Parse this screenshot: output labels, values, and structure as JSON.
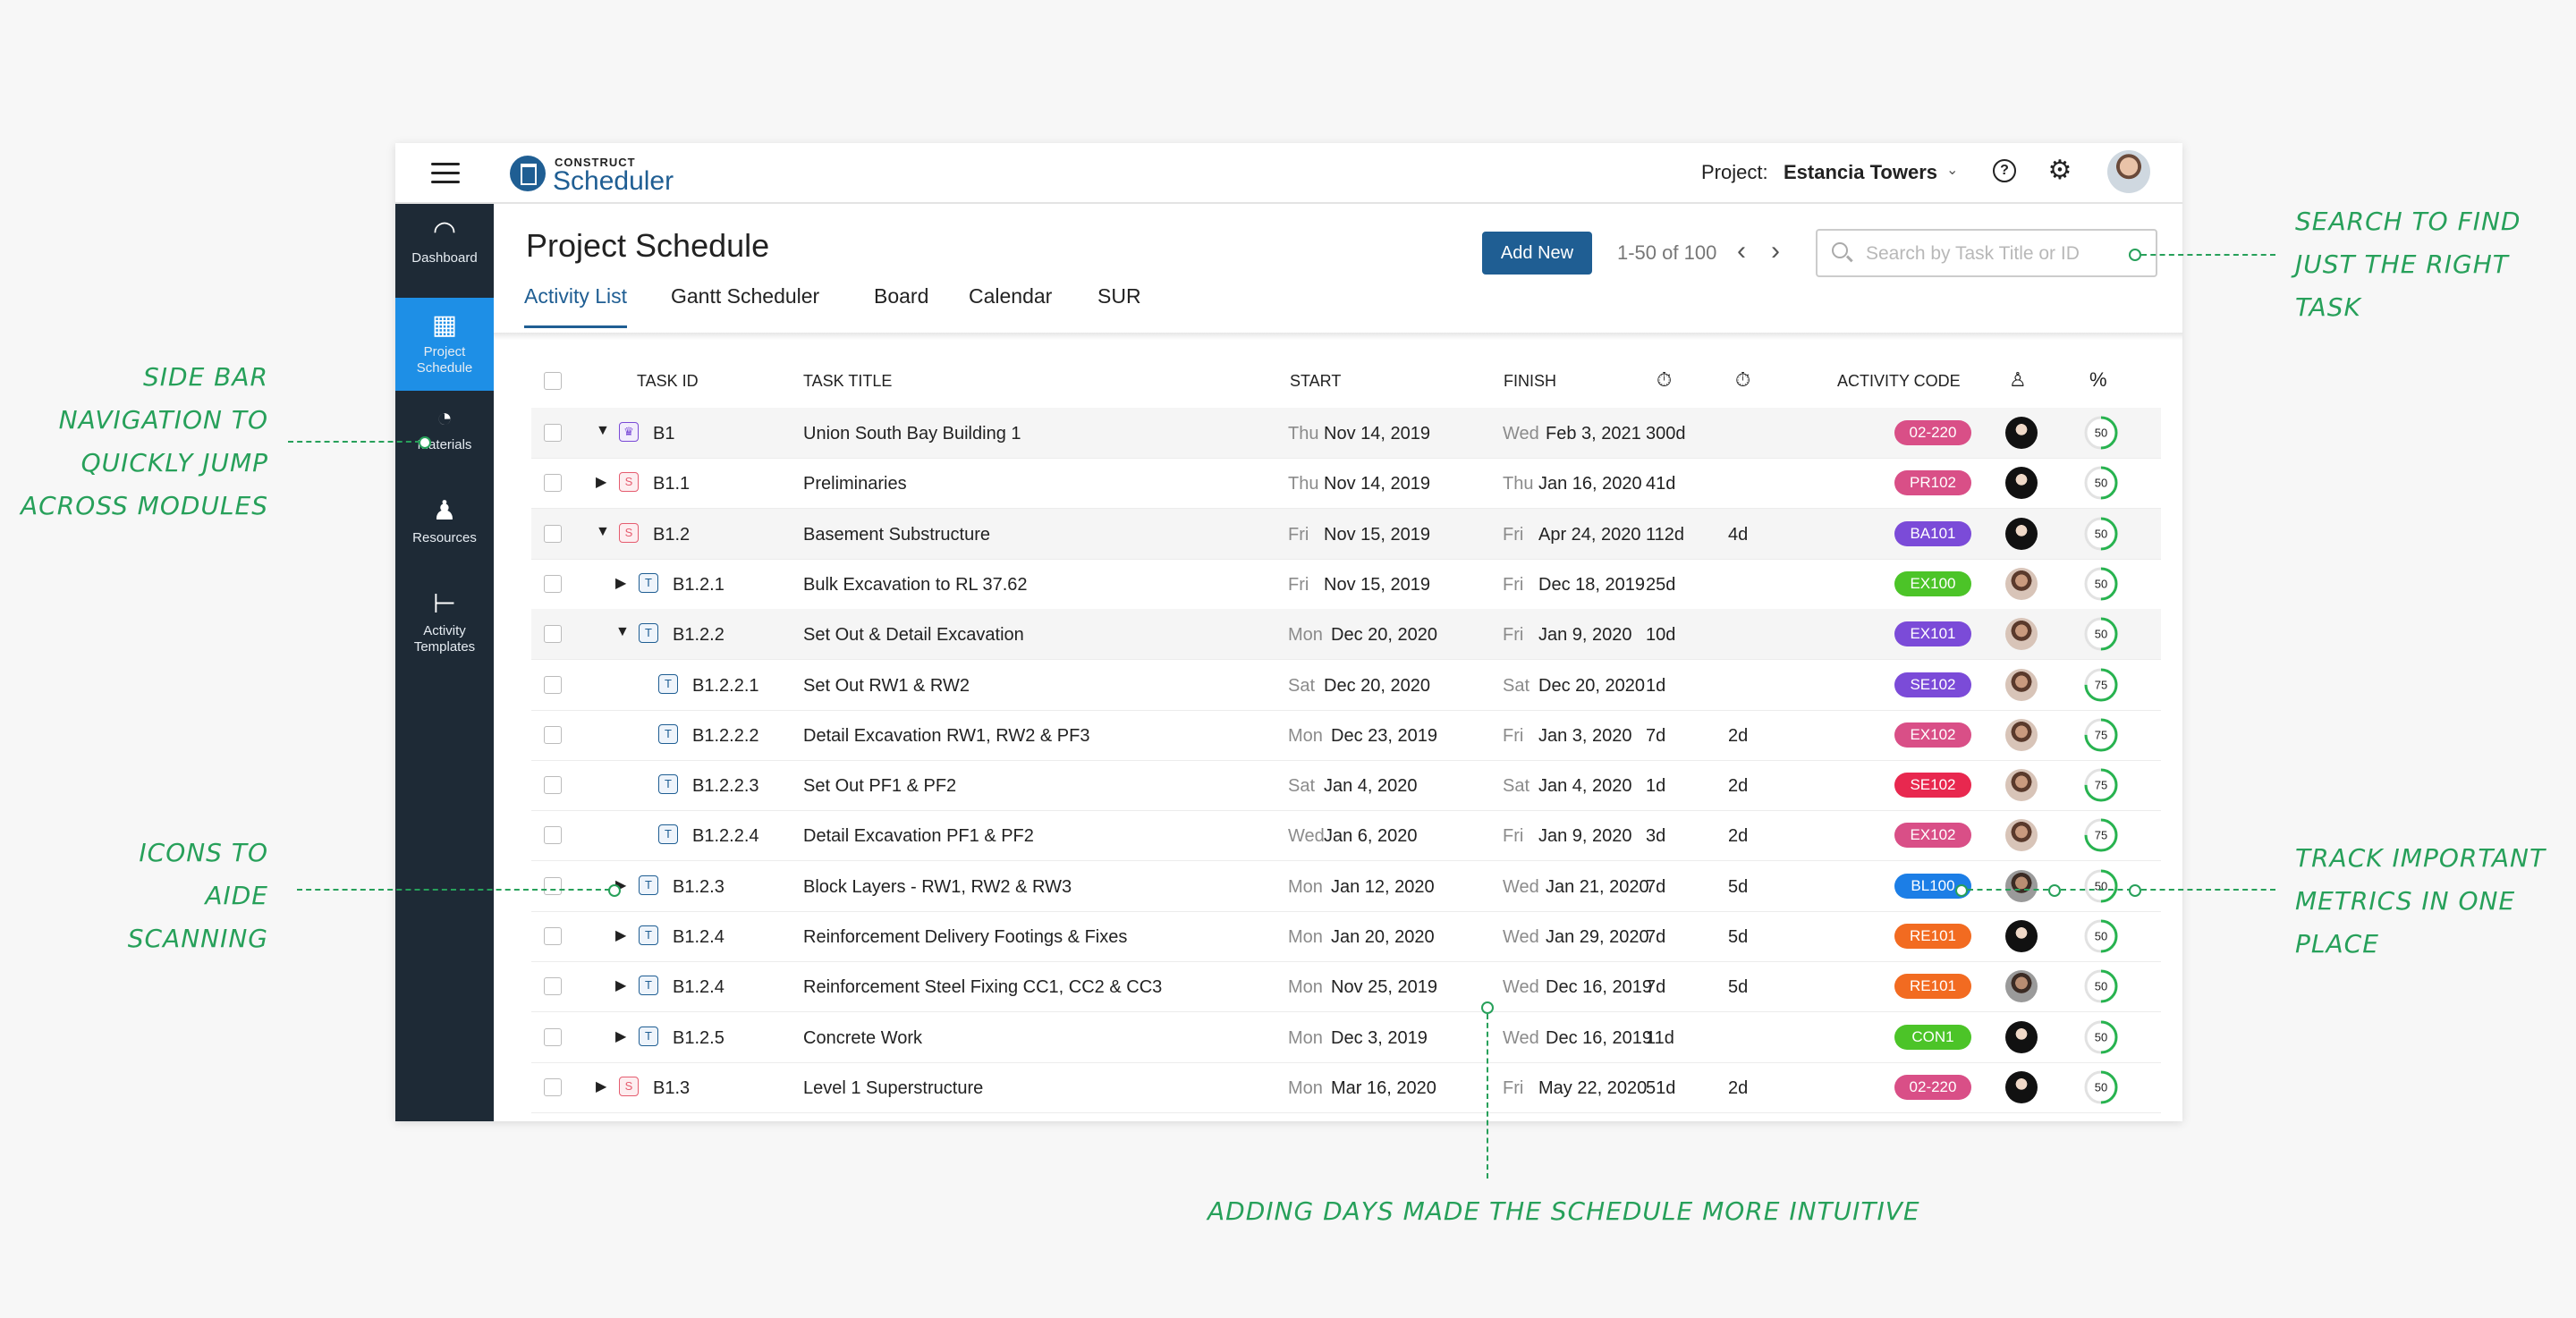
{
  "app": {
    "brand_small": "CONSTRUCT",
    "brand_big": "Scheduler",
    "project_label": "Project:",
    "project_name": "Estancia Towers"
  },
  "sidebar": {
    "items": [
      {
        "label": "Dashboard",
        "icon": "gauge-icon",
        "glyph": "◠"
      },
      {
        "label": "Project Schedule",
        "icon": "calendar-check-icon",
        "glyph": "▦"
      },
      {
        "label": "Materials",
        "icon": "pie-chart-icon",
        "glyph": "◔"
      },
      {
        "label": "Resources",
        "icon": "person-icon",
        "glyph": "♟"
      },
      {
        "label": "Activity Templates",
        "icon": "hierarchy-icon",
        "glyph": "⊢"
      }
    ]
  },
  "page": {
    "title": "Project Schedule",
    "add_button": "Add New",
    "pager_text": "1-50 of 100",
    "search_placeholder": "Search by Task Title or ID",
    "tabs": [
      "Activity List",
      "Gantt Scheduler",
      "Board",
      "Calendar",
      "SUR"
    ]
  },
  "table": {
    "headers": {
      "task_id": "TASK ID",
      "task_title": "TASK TITLE",
      "start": "START",
      "finish": "FINISH",
      "activity_code": "ACTIVITY CODE"
    },
    "rows": [
      {
        "expand": "down",
        "indent": 0,
        "type": "C",
        "id": "B1",
        "title": "Union South Bay Building 1",
        "start_day": "Thu",
        "start_date": "Nov 14, 2019",
        "finish_day": "Wed",
        "finish_date": "Feb 3, 2021",
        "duration": "300d",
        "float": "",
        "code": "02-220",
        "code_color": "#d94f87",
        "avatar": "dark",
        "percent": 50
      },
      {
        "expand": "right",
        "indent": 0,
        "type": "S",
        "id": "B1.1",
        "title": "Preliminaries",
        "start_day": "Thu",
        "start_date": "Nov 14, 2019",
        "finish_day": "Thu",
        "finish_date": "Jan 16, 2020",
        "duration": "41d",
        "float": "",
        "code": "PR102",
        "code_color": "#d94f87",
        "avatar": "dark",
        "percent": 50
      },
      {
        "expand": "down",
        "indent": 0,
        "type": "S",
        "id": "B1.2",
        "title": "Basement Substructure",
        "start_day": "Fri",
        "start_date": "Nov 15, 2019",
        "finish_day": "Fri",
        "finish_date": "Apr 24, 2020",
        "duration": "112d",
        "float": "4d",
        "code": "BA101",
        "code_color": "#7b4bd8",
        "avatar": "dark",
        "percent": 50
      },
      {
        "expand": "right",
        "indent": 1,
        "type": "T",
        "id": "B1.2.1",
        "title": "Bulk Excavation to RL 37.62",
        "start_day": "Fri",
        "start_date": "Nov 15, 2019",
        "finish_day": "Fri",
        "finish_date": "Dec 18, 2019",
        "duration": "25d",
        "float": "",
        "code": "EX100",
        "code_color": "#4cc428",
        "avatar": "light",
        "percent": 50
      },
      {
        "expand": "down",
        "indent": 1,
        "type": "T",
        "id": "B1.2.2",
        "title": "Set Out & Detail Excavation",
        "start_day": "Mon",
        "start_date": "Dec 20, 2020",
        "finish_day": "Fri",
        "finish_date": "Jan 9, 2020",
        "duration": "10d",
        "float": "",
        "code": "EX101",
        "code_color": "#7b4bd8",
        "avatar": "light",
        "percent": 50
      },
      {
        "expand": "",
        "indent": 2,
        "type": "T",
        "id": "B1.2.2.1",
        "title": "Set Out RW1 & RW2",
        "start_day": "Sat",
        "start_date": "Dec 20, 2020",
        "finish_day": "Sat",
        "finish_date": "Dec 20, 2020",
        "duration": "1d",
        "float": "",
        "code": "SE102",
        "code_color": "#7b4bd8",
        "avatar": "light",
        "percent": 75
      },
      {
        "expand": "",
        "indent": 2,
        "type": "T",
        "id": "B1.2.2.2",
        "title": "Detail Excavation RW1, RW2 & PF3",
        "start_day": "Mon",
        "start_date": "Dec 23, 2019",
        "finish_day": "Fri",
        "finish_date": "Jan 3, 2020",
        "duration": "7d",
        "float": "2d",
        "code": "EX102",
        "code_color": "#d94f87",
        "avatar": "light",
        "percent": 75
      },
      {
        "expand": "",
        "indent": 2,
        "type": "T",
        "id": "B1.2.2.3",
        "title": "Set Out PF1 & PF2",
        "start_day": "Sat",
        "start_date": "Jan 4, 2020",
        "finish_day": "Sat",
        "finish_date": "Jan 4, 2020",
        "duration": "1d",
        "float": "2d",
        "code": "SE102",
        "code_color": "#e8284f",
        "avatar": "light",
        "percent": 75
      },
      {
        "expand": "",
        "indent": 2,
        "type": "T",
        "id": "B1.2.2.4",
        "title": "Detail Excavation PF1 & PF2",
        "start_day": "Wed",
        "start_date": "Jan 6, 2020",
        "finish_day": "Fri",
        "finish_date": "Jan 9, 2020",
        "duration": "3d",
        "float": "2d",
        "code": "EX102",
        "code_color": "#d94f87",
        "avatar": "light",
        "percent": 75
      },
      {
        "expand": "right",
        "indent": 1,
        "type": "T",
        "id": "B1.2.3",
        "title": "Block Layers - RW1, RW2 & RW3",
        "start_day": "Mon",
        "start_date": "Jan 12, 2020",
        "finish_day": "Wed",
        "finish_date": "Jan 21, 2020",
        "duration": "7d",
        "float": "5d",
        "code": "BL100",
        "code_color": "#1c7ee6",
        "avatar": "mid",
        "percent": 50
      },
      {
        "expand": "right",
        "indent": 1,
        "type": "T",
        "id": "B1.2.4",
        "title": "Reinforcement Delivery Footings & Fixes",
        "start_day": "Mon",
        "start_date": "Jan 20, 2020",
        "finish_day": "Wed",
        "finish_date": "Jan 29, 2020",
        "duration": "7d",
        "float": "5d",
        "code": "RE101",
        "code_color": "#f26b21",
        "avatar": "dark",
        "percent": 50
      },
      {
        "expand": "right",
        "indent": 1,
        "type": "T",
        "id": "B1.2.4",
        "title": "Reinforcement Steel Fixing CC1, CC2 & CC3",
        "start_day": "Mon",
        "start_date": "Nov 25, 2019",
        "finish_day": "Wed",
        "finish_date": "Dec 16, 2019",
        "duration": "7d",
        "float": "5d",
        "code": "RE101",
        "code_color": "#f26b21",
        "avatar": "mid",
        "percent": 50
      },
      {
        "expand": "right",
        "indent": 1,
        "type": "T",
        "id": "B1.2.5",
        "title": "Concrete Work",
        "start_day": "Mon",
        "start_date": "Dec 3, 2019",
        "finish_day": "Wed",
        "finish_date": "Dec 16, 2019",
        "duration": "11d",
        "float": "",
        "code": "CON1",
        "code_color": "#4cc428",
        "avatar": "dark",
        "percent": 50
      },
      {
        "expand": "right",
        "indent": 0,
        "type": "S",
        "id": "B1.3",
        "title": "Level 1 Superstructure",
        "start_day": "Mon",
        "start_date": "Mar 16, 2020",
        "finish_day": "Fri",
        "finish_date": "May 22, 2020",
        "duration": "51d",
        "float": "2d",
        "code": "02-220",
        "code_color": "#d94f87",
        "avatar": "dark",
        "percent": 50
      }
    ]
  },
  "annotations": {
    "sidebar": [
      "SIDE BAR",
      "NAVIGATION TO",
      "QUICKLY JUMP",
      "ACROSS MODULES"
    ],
    "icons": [
      "ICONS TO",
      "AIDE",
      "SCANNING"
    ],
    "search": [
      "SEARCH TO FIND",
      "JUST THE RIGHT",
      "TASK"
    ],
    "metrics": [
      "TRACK IMPORTANT",
      "METRICS IN ONE",
      "PLACE"
    ],
    "days": "ADDING DAYS MADE THE SCHEDULE MORE INTUITIVE"
  },
  "colors": {
    "accent": "#1f5e93",
    "sidebar_bg": "#1e2a36",
    "sidebar_active": "#1e8fe6",
    "annotation": "#27a05a",
    "progress": "#27b34f"
  }
}
